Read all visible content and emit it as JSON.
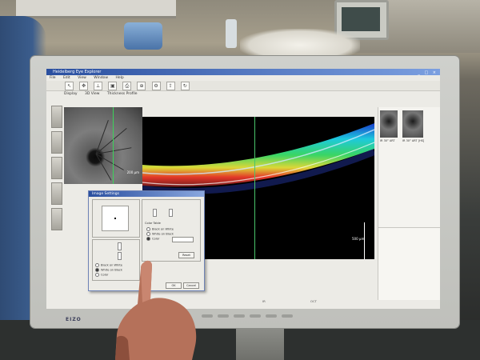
{
  "screen": {
    "window_title": "Heidelberg Eye Explorer",
    "menu": [
      "File",
      "Edit",
      "View",
      "Window",
      "Help"
    ],
    "tabs": [
      "Display",
      "3D View",
      "Thickness Profile"
    ],
    "toolbar_icons": [
      "select-icon",
      "pan-icon",
      "measure-icon",
      "save-icon",
      "print-icon",
      "zoom-icon",
      "settings-icon",
      "export-icon",
      "refresh-icon"
    ],
    "fundus": {
      "scale_label": "200 µm"
    },
    "oct": {
      "scale_label": "500 µm"
    },
    "thumbnails_right": [
      {
        "caption": "IR 30°  ART"
      },
      {
        "caption": "IR 30°  ART [HS]"
      }
    ],
    "status": [
      "IR",
      "OCT",
      "Image Settings"
    ]
  },
  "dialog": {
    "title": "Image Settings",
    "color_label": "Color Table",
    "radio_options": [
      "Black on White",
      "White on Black",
      "Color"
    ],
    "ok_label": "OK",
    "cancel_label": "Cancel",
    "reset_label": "Reset"
  },
  "monitor": {
    "brand": "EIZO"
  },
  "colors": {
    "titlebar": "#2a4f9f",
    "scan_line": "#3cd35a",
    "oct_bg": "#000000"
  }
}
